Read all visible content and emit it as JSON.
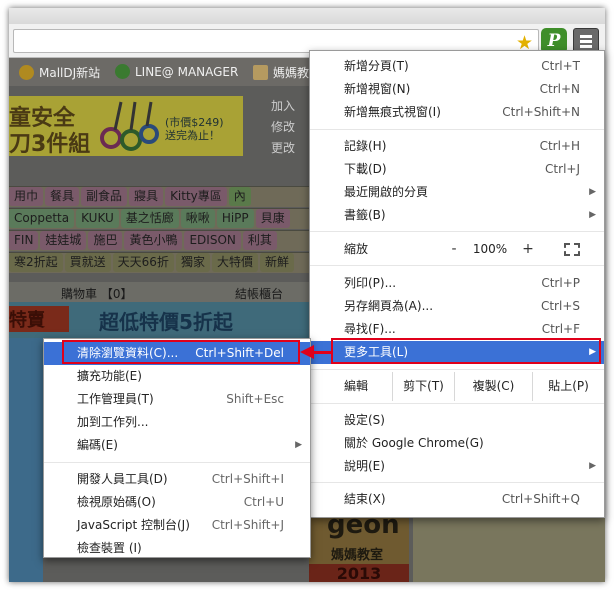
{
  "bookmarks": [
    {
      "label": "MallDJ新站",
      "icon": "heart-icon",
      "color": "#d3a000"
    },
    {
      "label": "LINE@ MANAGER",
      "icon": "line-app-icon",
      "color": "#3cb043"
    },
    {
      "label": "媽媽教",
      "icon": "folder-icon",
      "color": "#e8c774"
    }
  ],
  "page": {
    "banner_line1": "童安全",
    "banner_line2": "刀3件組",
    "banner_price": "(市價$249)\n送完為止！",
    "side_links": [
      "加入",
      "修改",
      "更改"
    ],
    "cat_rows": [
      [
        "用巾",
        "餐具",
        "副食品",
        "寢具",
        "Kitty專區",
        "內"
      ],
      [
        "Coppetta",
        "KUKU",
        "基之恬廊",
        "啾啾",
        "HiPP",
        "貝康"
      ],
      [
        "FIN",
        "娃娃城",
        "施巴",
        "黃色小鴨",
        "EDISON",
        "利其"
      ],
      [
        "寒2折起",
        "買就送",
        "天天66折",
        "獨家",
        "大特價",
        "新鮮"
      ]
    ],
    "cart_label": "購物車 【0】",
    "checkout_label": "結帳櫃台",
    "promo_left": "特賣",
    "promo_text": "超低特價5折起",
    "logo_text": "geon",
    "logo_sub": "媽媽教室",
    "year_text": "2013"
  },
  "menu": {
    "items": [
      {
        "label": "新增分頁(T)",
        "shortcut": "Ctrl+T"
      },
      {
        "label": "新增視窗(N)",
        "shortcut": "Ctrl+N"
      },
      {
        "label": "新增無痕式視窗(I)",
        "shortcut": "Ctrl+Shift+N"
      },
      {
        "label": "記錄(H)",
        "shortcut": "Ctrl+H"
      },
      {
        "label": "下載(D)",
        "shortcut": "Ctrl+J"
      },
      {
        "label": "最近開啟的分頁",
        "shortcut": ""
      },
      {
        "label": "書籤(B)",
        "shortcut": ""
      }
    ],
    "zoom": {
      "label": "縮放",
      "minus": "-",
      "value": "100%",
      "plus": "+"
    },
    "items2": [
      {
        "label": "列印(P)...",
        "shortcut": "Ctrl+P"
      },
      {
        "label": "另存網頁為(A)...",
        "shortcut": "Ctrl+S"
      },
      {
        "label": "尋找(F)...",
        "shortcut": "Ctrl+F"
      }
    ],
    "more_tools": "更多工具(L)",
    "edit": {
      "label": "編輯",
      "cut": "剪下(T)",
      "copy": "複製(C)",
      "paste": "貼上(P)"
    },
    "items3": [
      {
        "label": "設定(S)"
      },
      {
        "label": "關於 Google Chrome(G)"
      },
      {
        "label": "說明(E)"
      }
    ],
    "exit": {
      "label": "結束(X)",
      "shortcut": "Ctrl+Shift+Q"
    }
  },
  "submenu": {
    "items": [
      {
        "label": "清除瀏覽資料(C)...",
        "shortcut": "Ctrl+Shift+Del"
      },
      {
        "label": "擴充功能(E)",
        "shortcut": ""
      },
      {
        "label": "工作管理員(T)",
        "shortcut": "Shift+Esc"
      },
      {
        "label": "加到工作列...",
        "shortcut": ""
      },
      {
        "label": "編碼(E)",
        "shortcut": ""
      },
      {
        "label": "開發人員工具(D)",
        "shortcut": "Ctrl+Shift+I"
      },
      {
        "label": "檢視原始碼(O)",
        "shortcut": "Ctrl+U"
      },
      {
        "label": "JavaScript 控制台(J)",
        "shortcut": "Ctrl+Shift+J"
      },
      {
        "label": "檢查裝置 (I)",
        "shortcut": ""
      }
    ]
  },
  "colors": {
    "highlight": "#3b71d6",
    "annotation": "#e0001a"
  }
}
